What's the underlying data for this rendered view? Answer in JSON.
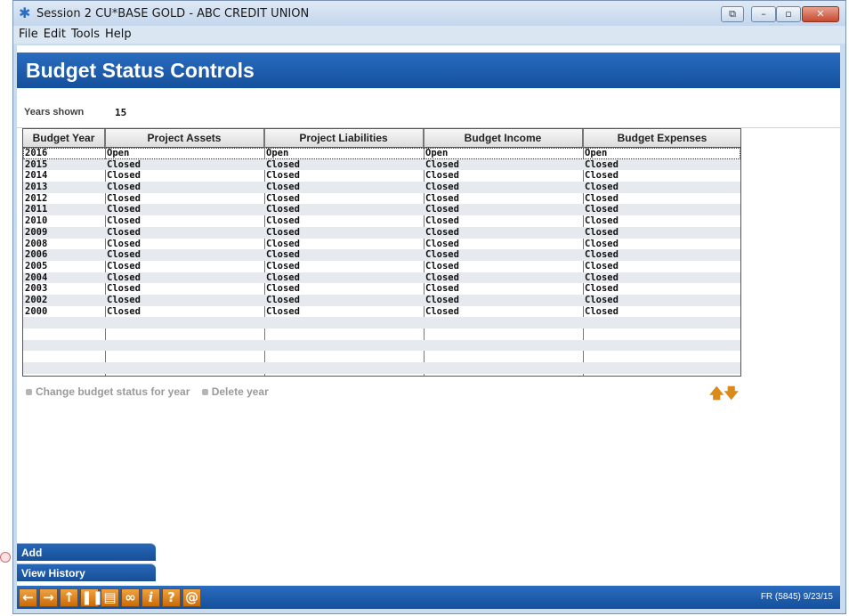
{
  "window": {
    "title": "Session 2 CU*BASE GOLD - ABC CREDIT UNION",
    "app_icon": "asterisk-icon",
    "controls": [
      "restore-icon",
      "minimize-icon",
      "maximize-icon",
      "close-icon"
    ]
  },
  "menu": [
    "File",
    "Edit",
    "Tools",
    "Help"
  ],
  "page": {
    "title": "Budget Status Controls",
    "years_shown_label": "Years shown",
    "years_shown_value": "15"
  },
  "table": {
    "columns": [
      "Budget Year",
      "Project Assets",
      "Project Liabilities",
      "Budget Income",
      "Budget Expenses"
    ],
    "rows": [
      [
        "2016",
        "Open",
        "Open",
        "Open",
        "Open"
      ],
      [
        "2015",
        "Closed",
        "Closed",
        "Closed",
        "Closed"
      ],
      [
        "2014",
        "Closed",
        "Closed",
        "Closed",
        "Closed"
      ],
      [
        "2013",
        "Closed",
        "Closed",
        "Closed",
        "Closed"
      ],
      [
        "2012",
        "Closed",
        "Closed",
        "Closed",
        "Closed"
      ],
      [
        "2011",
        "Closed",
        "Closed",
        "Closed",
        "Closed"
      ],
      [
        "2010",
        "Closed",
        "Closed",
        "Closed",
        "Closed"
      ],
      [
        "2009",
        "Closed",
        "Closed",
        "Closed",
        "Closed"
      ],
      [
        "2008",
        "Closed",
        "Closed",
        "Closed",
        "Closed"
      ],
      [
        "2006",
        "Closed",
        "Closed",
        "Closed",
        "Closed"
      ],
      [
        "2005",
        "Closed",
        "Closed",
        "Closed",
        "Closed"
      ],
      [
        "2004",
        "Closed",
        "Closed",
        "Closed",
        "Closed"
      ],
      [
        "2003",
        "Closed",
        "Closed",
        "Closed",
        "Closed"
      ],
      [
        "2002",
        "Closed",
        "Closed",
        "Closed",
        "Closed"
      ],
      [
        "2000",
        "Closed",
        "Closed",
        "Closed",
        "Closed"
      ]
    ],
    "empty_rows": 5
  },
  "actions": [
    "Change budget status for year",
    "Delete year"
  ],
  "function_buttons": [
    "Add",
    "View History"
  ],
  "toolbar": [
    "back-arrow-icon",
    "forward-arrow-icon",
    "up-arrow-icon",
    "pause-icon",
    "print-icon",
    "link-icon",
    "info-icon",
    "help-icon",
    "at-sign-icon"
  ],
  "status": "FR (5845) 9/23/15",
  "colors": {
    "header": "#1d5fb0",
    "toolbar_button": "#e08a25",
    "scroll_arrows": "#d98a1a"
  }
}
